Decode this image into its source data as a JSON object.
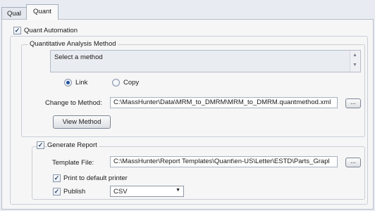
{
  "tabs": [
    {
      "label": "Qual",
      "active": false
    },
    {
      "label": "Quant",
      "active": true
    }
  ],
  "quant_automation": {
    "label": "Quant Automation",
    "checked": true
  },
  "method_group": {
    "title": "Quantitative Analysis Method",
    "list_text": "Select a method",
    "radio_link": {
      "label": "Link",
      "selected": true
    },
    "radio_copy": {
      "label": "Copy",
      "selected": false
    },
    "change_label": "Change to Method:",
    "change_value": "C:\\MassHunter\\Data\\MRM_to_DMRM\\MRM_to_DMRM.quantmethod.xml",
    "browse_label": "...",
    "view_method_label": "View Method"
  },
  "report_group": {
    "generate": {
      "label": "Generate Report",
      "checked": true
    },
    "template_label": "Template File:",
    "template_value": "C:\\MassHunter\\Report Templates\\Quant\\en-US\\Letter\\ESTD\\Parts_Grapl",
    "browse_label": "...",
    "print": {
      "label": "Print to default printer",
      "checked": true
    },
    "publish": {
      "label": "Publish",
      "checked": true
    },
    "publish_format": "CSV"
  },
  "check_glyph": "✓",
  "colors": {
    "accent": "#1d4f9e",
    "panel_bg": "#f6f6f6",
    "outer_bg": "#e8ecf2"
  }
}
